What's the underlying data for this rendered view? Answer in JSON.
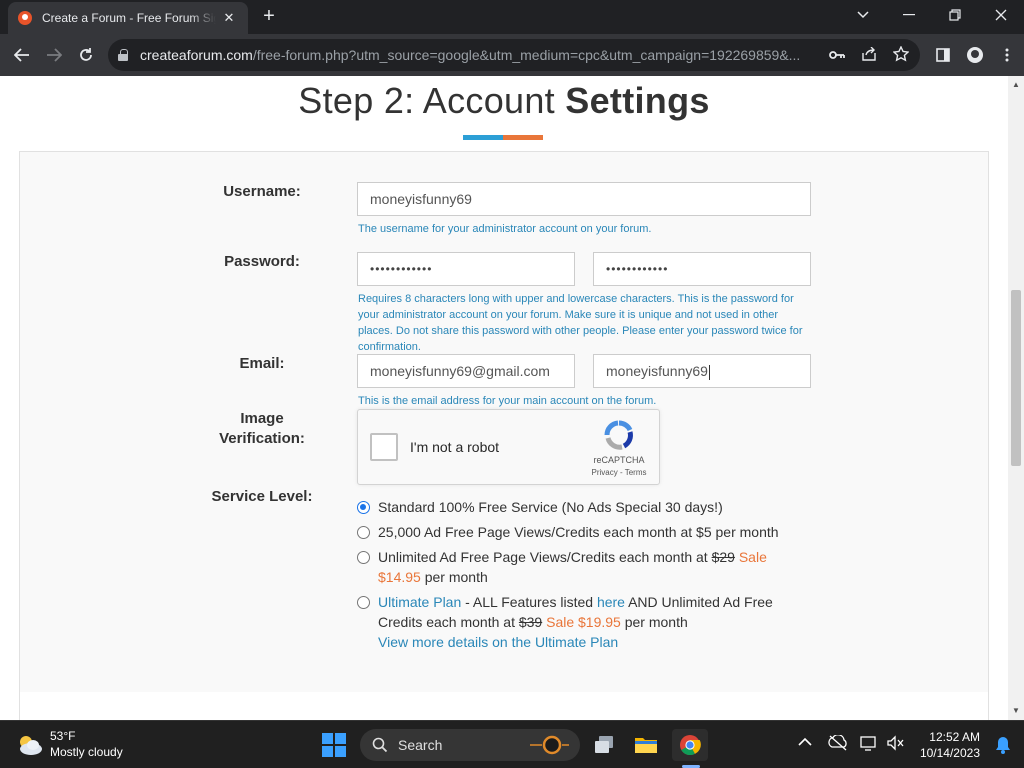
{
  "browser": {
    "tab_title": "Create a Forum - Free Forum Sign Up",
    "url_host": "createaforum.com",
    "url_path": "/free-forum.php?utm_source=google&utm_medium=cpc&utm_campaign=192269859&...",
    "new_tab": "+",
    "close_tab": "✕"
  },
  "page": {
    "heading_light": "Step 2: Account ",
    "heading_bold": "Settings",
    "accent_colors": {
      "blue": "#2c9fd6",
      "orange": "#e9763a"
    }
  },
  "form": {
    "username_label": "Username:",
    "username_value": "moneyisfunny69",
    "username_help": "The username for your administrator account on your forum.",
    "password_label": "Password:",
    "password_value": "••••••••••••",
    "password_confirm_value": "••••••••••••",
    "password_help": "Requires 8 characters long with upper and lowercase characters. This is the password for your administrator account on your forum. Make sure it is unique and not used in other places. Do not share this password with other people. Please enter your password twice for confirmation.",
    "email_label": "Email:",
    "email_value": "moneyisfunny69@gmail.com",
    "email_confirm_value": "moneyisfunny69",
    "email_help": "This is the email address for your main account on the forum.",
    "image_verification_label_1": "Image",
    "image_verification_label_2": "Verification:",
    "recaptcha": {
      "text": "I'm not a robot",
      "brand": "reCAPTCHA",
      "links": "Privacy - Terms"
    },
    "service_label": "Service Level:",
    "service_options": [
      {
        "text": "Standard 100% Free Service (No Ads Special 30 days!)",
        "checked": true
      },
      {
        "text": "25,000 Ad Free Page Views/Credits each month at $5 per month",
        "checked": false
      },
      {
        "text_pre": "Unlimited Ad Free Page Views/Credits each month at ",
        "old_price": "$29",
        "sale": "Sale $14.95",
        "text_post": " per month",
        "checked": false
      },
      {
        "link1": "Ultimate Plan",
        "text1": " - ALL Features listed ",
        "link2": "here",
        "text2": " AND Unlimited Ad Free Credits each month at ",
        "old_price": "$39",
        "sale": "Sale $19.95",
        "text_post": " per month",
        "details_link": "View more details on the Ultimate Plan",
        "checked": false
      }
    ]
  },
  "taskbar": {
    "temperature": "53°F",
    "condition": "Mostly cloudy",
    "search_label": "Search",
    "time": "12:52 AM",
    "date": "10/14/2023"
  }
}
